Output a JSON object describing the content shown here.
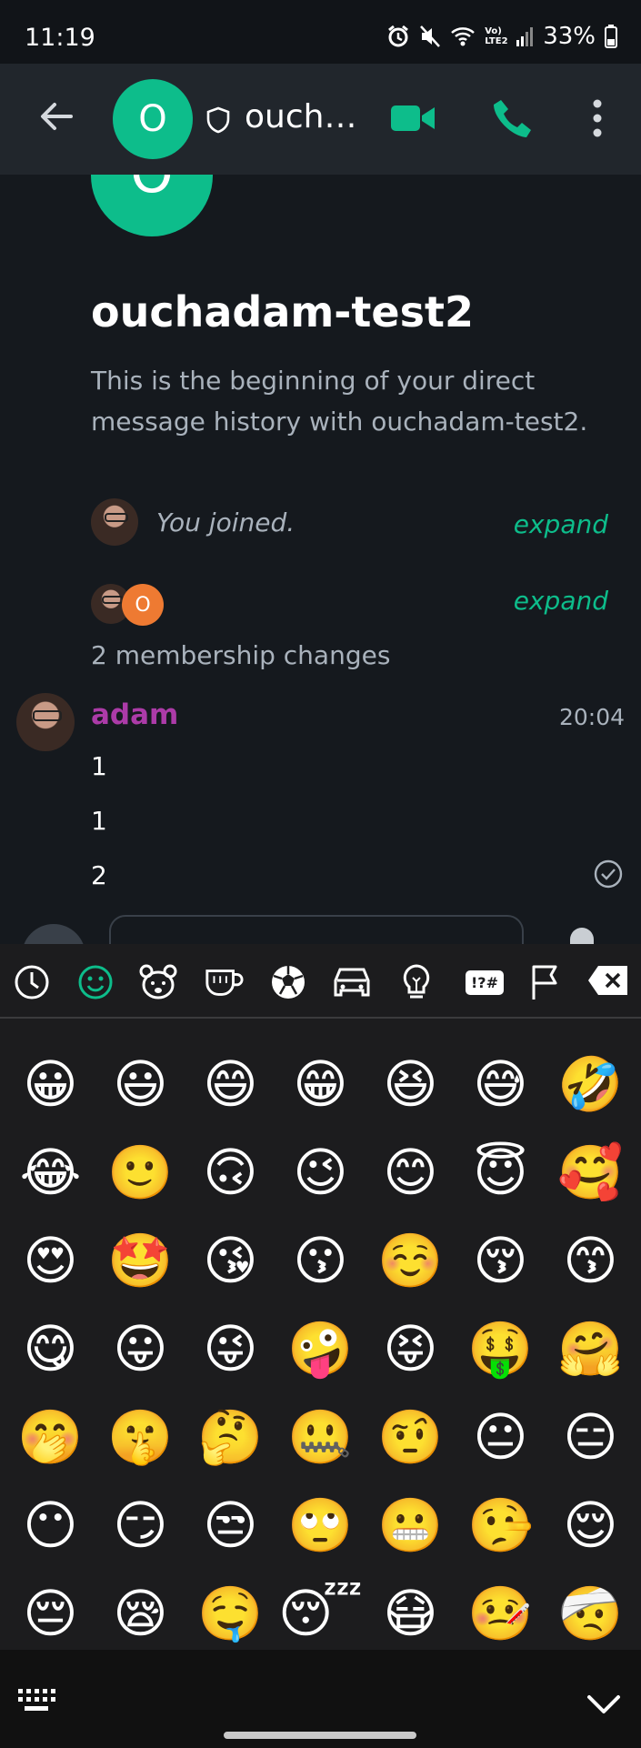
{
  "status_bar": {
    "time": "11:19",
    "network_label": "Vo) LTE2",
    "battery": "33%"
  },
  "header": {
    "avatar_letter": "O",
    "title": "ouch…",
    "accent_color": "#0dbd8b"
  },
  "room": {
    "avatar_letter": "O",
    "name": "ouchadam-test2",
    "intro": "This is the beginning of your direct message history with ouchadam-test2."
  },
  "timeline": {
    "event1": {
      "text": "You joined.",
      "expand": "expand"
    },
    "event2": {
      "avatar_letter": "O",
      "text": "2 membership changes",
      "expand": "expand"
    },
    "message": {
      "sender": "adam",
      "time": "20:04",
      "lines": [
        "1",
        "1",
        "2"
      ]
    }
  },
  "keyboard": {
    "categories": [
      "recent-icon",
      "smileys-icon",
      "animals-icon",
      "food-icon",
      "activity-icon",
      "travel-icon",
      "objects-icon",
      "symbols-icon",
      "flags-icon"
    ],
    "symbols_label": "!?#",
    "emoji_rows": [
      [
        "😀",
        "😃",
        "😄",
        "😁",
        "😆",
        "😅",
        "🤣"
      ],
      [
        "😂",
        "🙂",
        "🙃",
        "😉",
        "😊",
        "😇",
        "🥰"
      ],
      [
        "😍",
        "🤩",
        "😘",
        "😗",
        "☺️",
        "😚",
        "😙"
      ],
      [
        "😋",
        "😛",
        "😜",
        "🤪",
        "😝",
        "🤑",
        "🤗"
      ],
      [
        "🤭",
        "🤫",
        "🤔",
        "🤐",
        "🤨",
        "😐",
        "😑"
      ],
      [
        "😶",
        "😏",
        "😒",
        "🙄",
        "😬",
        "🤥",
        "😌"
      ],
      [
        "😔",
        "😪",
        "🤤",
        "😴",
        "😷",
        "🤒",
        "🤕"
      ]
    ]
  }
}
